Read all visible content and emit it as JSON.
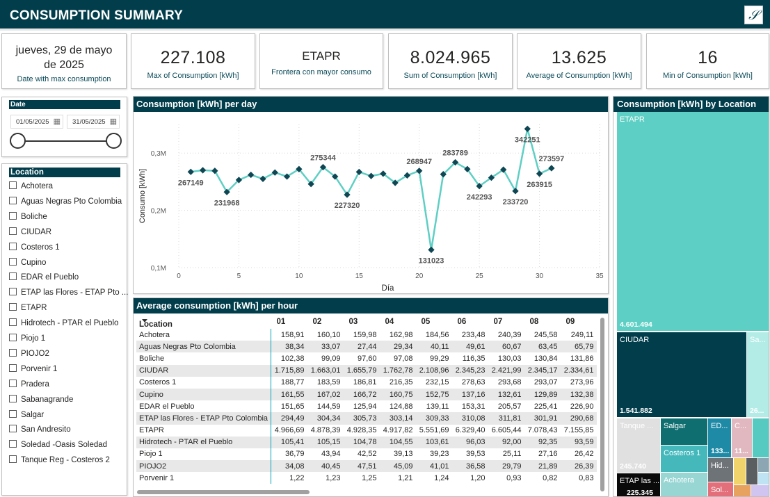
{
  "header": {
    "title": "CONSUMPTION SUMMARY",
    "logo_text": "𝒮"
  },
  "cards": {
    "date": {
      "value": "jueves, 29 de mayo de 2025",
      "label": "Date with max consumption"
    },
    "max": {
      "value": "227.108",
      "label": "Max of Consumption [kWh]"
    },
    "frontera": {
      "value": "ETAPR",
      "label": "Frontera con mayor consumo"
    },
    "sum": {
      "value": "8.024.965",
      "label": "Sum of Consumption [kWh]"
    },
    "avg": {
      "value": "13.625",
      "label": "Average of Consumption [kWh]"
    },
    "min": {
      "value": "16",
      "label": "Min of Consumption [kWh]"
    }
  },
  "date_slicer": {
    "title": "Date",
    "start": "01/05/2025",
    "end": "31/05/2025"
  },
  "location_slicer": {
    "title": "Location",
    "items": [
      "Achotera",
      "Aguas Negras Pto Colombia",
      "Boliche",
      "CIUDAR",
      "Costeros 1",
      "Cupino",
      "EDAR el Pueblo",
      "ETAP las Flores - ETAP Pto ...",
      "ETAPR",
      "Hidrotech - PTAR el Pueblo",
      "Piojo 1",
      "PIOJO2",
      "Porvenir 1",
      "Pradera",
      "Sabanagrande",
      "Salgar",
      "San Andresito",
      "Soledad -Oasis Soledad",
      "Tanque Reg - Costeros 2"
    ]
  },
  "line_chart": {
    "title": "Consumption [kWh] per day",
    "colors": {
      "line": "#5ecfc4",
      "marker": "#0f4653"
    }
  },
  "chart_data": {
    "type": "line",
    "title": "Consumption [kWh] per day",
    "xlabel": "Día",
    "ylabel": "Consumo [kWh]",
    "xlim": [
      0,
      35
    ],
    "ylim": [
      100000,
      350000
    ],
    "x_ticks": [
      "0",
      "5",
      "10",
      "15",
      "20",
      "25",
      "30",
      "35"
    ],
    "y_ticks": [
      "0,1M",
      "0,2M",
      "0,3M"
    ],
    "y_tick_values": [
      100000,
      200000,
      300000
    ],
    "grid": true,
    "x": [
      1,
      2,
      3,
      4,
      5,
      6,
      7,
      8,
      9,
      10,
      11,
      12,
      13,
      14,
      15,
      16,
      17,
      18,
      19,
      20,
      21,
      22,
      23,
      24,
      25,
      26,
      27,
      28,
      29,
      30,
      31
    ],
    "values": [
      267149,
      270000,
      269000,
      231968,
      253000,
      262000,
      255000,
      266000,
      259000,
      272000,
      246000,
      275344,
      259000,
      227320,
      267000,
      260000,
      264000,
      248000,
      261000,
      268947,
      131023,
      263000,
      283789,
      272000,
      242293,
      257000,
      271000,
      233720,
      342251,
      263915,
      273597
    ],
    "data_labels": [
      {
        "day": 1,
        "text": "267149",
        "pos": "below"
      },
      {
        "day": 4,
        "text": "231968",
        "pos": "below"
      },
      {
        "day": 12,
        "text": "275344",
        "pos": "above"
      },
      {
        "day": 14,
        "text": "227320",
        "pos": "below"
      },
      {
        "day": 20,
        "text": "268947",
        "pos": "above"
      },
      {
        "day": 21,
        "text": "131023",
        "pos": "below"
      },
      {
        "day": 23,
        "text": "283789",
        "pos": "above"
      },
      {
        "day": 25,
        "text": "242293",
        "pos": "below"
      },
      {
        "day": 28,
        "text": "233720",
        "pos": "below"
      },
      {
        "day": 29,
        "text": "342251",
        "pos": "below"
      },
      {
        "day": 30,
        "text": "263915",
        "pos": "below"
      },
      {
        "day": 31,
        "text": "273597",
        "pos": "above"
      }
    ]
  },
  "hourly_table": {
    "title": "Average consumption [kWh] per hour",
    "columns": [
      "Location",
      "01",
      "02",
      "03",
      "04",
      "05",
      "06",
      "07",
      "08",
      "09"
    ],
    "rows": [
      [
        "Achotera",
        "158,91",
        "160,10",
        "159,98",
        "162,98",
        "184,56",
        "233,48",
        "240,39",
        "245,58",
        "249,11"
      ],
      [
        "Aguas Negras Pto Colombia",
        "38,34",
        "33,07",
        "27,44",
        "29,34",
        "40,11",
        "49,61",
        "60,67",
        "63,45",
        "65,79"
      ],
      [
        "Boliche",
        "102,38",
        "99,09",
        "97,60",
        "97,08",
        "99,29",
        "116,35",
        "130,03",
        "130,84",
        "131,86"
      ],
      [
        "CIUDAR",
        "1.715,89",
        "1.663,01",
        "1.655,79",
        "1.762,78",
        "2.108,96",
        "2.345,23",
        "2.421,99",
        "2.345,17",
        "2.334,61"
      ],
      [
        "Costeros 1",
        "188,77",
        "183,59",
        "186,81",
        "216,35",
        "232,15",
        "278,63",
        "293,68",
        "293,07",
        "273,96"
      ],
      [
        "Cupino",
        "161,55",
        "167,02",
        "166,72",
        "160,75",
        "152,75",
        "137,16",
        "132,61",
        "129,89",
        "132,38"
      ],
      [
        "EDAR el Pueblo",
        "151,65",
        "144,59",
        "125,94",
        "124,88",
        "139,11",
        "153,31",
        "205,57",
        "225,41",
        "226,90"
      ],
      [
        "ETAP las Flores - ETAP Pto Colombia",
        "294,49",
        "304,34",
        "305,73",
        "303,14",
        "309,33",
        "310,08",
        "311,81",
        "301,91",
        "290,68"
      ],
      [
        "ETAPR",
        "4.966,69",
        "4.878,39",
        "4.928,35",
        "4.917,82",
        "5.551,69",
        "6.329,40",
        "6.605,44",
        "7.078,43",
        "7.155,85"
      ],
      [
        "Hidrotech - PTAR el Pueblo",
        "105,41",
        "105,15",
        "104,78",
        "104,55",
        "103,61",
        "96,03",
        "92,00",
        "92,35",
        "93,59"
      ],
      [
        "Piojo 1",
        "36,79",
        "43,94",
        "42,52",
        "39,13",
        "39,23",
        "39,53",
        "25,11",
        "27,16",
        "26,42"
      ],
      [
        "PIOJO2",
        "34,08",
        "40,45",
        "47,51",
        "45,09",
        "41,01",
        "36,58",
        "29,79",
        "21,89",
        "26,39"
      ],
      [
        "Porvenir 1",
        "1,22",
        "1,23",
        "1,25",
        "1,21",
        "1,24",
        "1,20",
        "0,93",
        "0,82",
        "0,83"
      ]
    ]
  },
  "treemap": {
    "title": "Consumption [kWh] by Location",
    "tiles": [
      {
        "label": "ETAPR",
        "value": "4.601.494",
        "color": "#5ecfc4"
      },
      {
        "label": "CIUDAR",
        "value": "1.541.882",
        "color": "#013d4b"
      },
      {
        "label": "Sa...",
        "value": "26...",
        "color": "#b3ece6"
      },
      {
        "label": "Tanque ...",
        "value": "245.740",
        "color": "#e0e0e0"
      },
      {
        "label": "Salgar",
        "value": "",
        "color": "#0f6e70"
      },
      {
        "label": "Costeros 1",
        "value": "",
        "color": "#45b8bc"
      },
      {
        "label": "Achotera",
        "value": "",
        "color": "#98d6d4"
      },
      {
        "label": "ETAP las ...",
        "value": "225.345",
        "color": "#0a0a0a"
      },
      {
        "label": "ED...",
        "value": "133...",
        "color": "#1f8aa6"
      },
      {
        "label": "C...",
        "value": "11...",
        "color": "#e2b8c0"
      },
      {
        "label": "Hid...",
        "value": "",
        "color": "#6e7378"
      },
      {
        "label": "Sol...",
        "value": "",
        "color": "#e26f7a"
      }
    ],
    "extra_colors": [
      "#56c9c0",
      "#f0d36a",
      "#5a5e61",
      "#8da6b3",
      "#bfe3f2",
      "#e8a25f",
      "#d0c5f0",
      "#c07fbc"
    ]
  }
}
